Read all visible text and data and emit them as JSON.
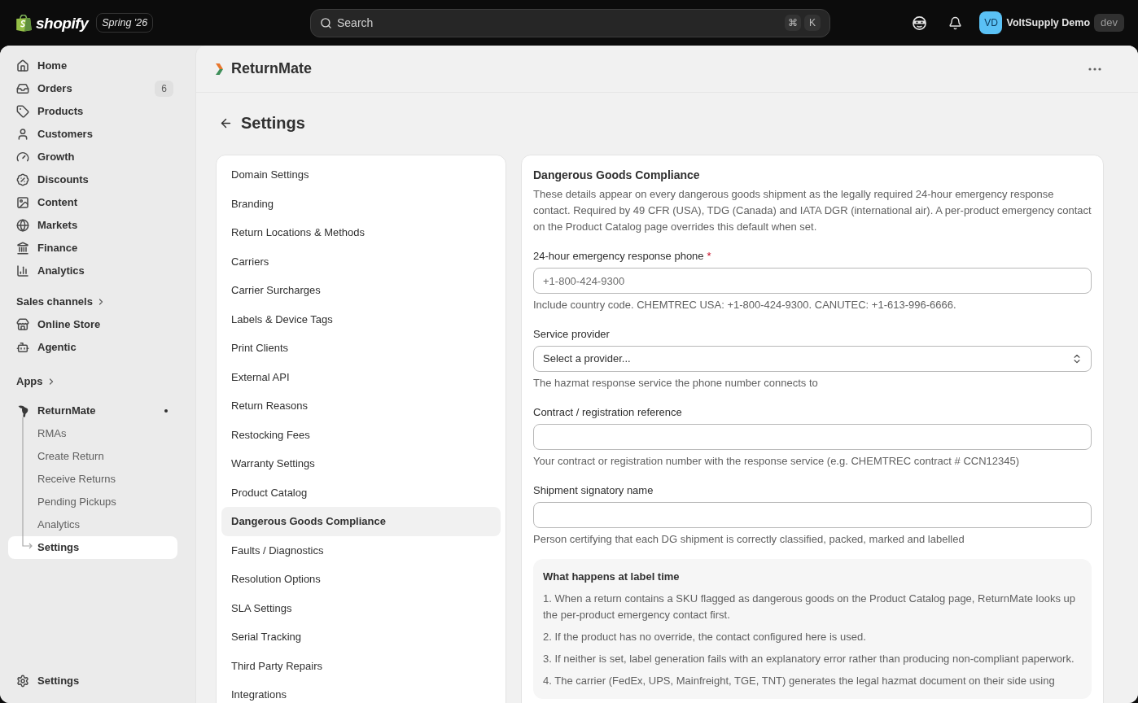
{
  "top_bar": {
    "brand": "shopify",
    "edition": "Spring '26",
    "search": {
      "placeholder": "Search",
      "shortcut": [
        "⌘",
        "K"
      ]
    },
    "account": {
      "initials": "VD",
      "store_name": "VoltSupply Demo",
      "badge": "dev"
    }
  },
  "sidebar": {
    "items": [
      {
        "label": "Home",
        "selected": false
      },
      {
        "label": "Orders",
        "count": "6",
        "selected": false
      },
      {
        "label": "Products",
        "selected": false
      },
      {
        "label": "Customers",
        "selected": false
      },
      {
        "label": "Growth",
        "selected": false
      },
      {
        "label": "Discounts",
        "selected": false
      },
      {
        "label": "Content",
        "selected": false
      },
      {
        "label": "Markets",
        "selected": false
      },
      {
        "label": "Finance",
        "selected": false
      },
      {
        "label": "Analytics",
        "selected": false
      }
    ],
    "sales_channels": {
      "heading": "Sales channels",
      "items": [
        {
          "label": "Online Store",
          "selected": false
        },
        {
          "label": "Agentic",
          "selected": false
        }
      ]
    },
    "apps": {
      "heading": "Apps",
      "items": [
        {
          "label": "ReturnMate",
          "selected": false,
          "indicator": true,
          "children": [
            {
              "label": "RMAs",
              "selected": false
            },
            {
              "label": "Create Return",
              "selected": false
            },
            {
              "label": "Receive Returns",
              "selected": false
            },
            {
              "label": "Pending Pickups",
              "selected": false
            },
            {
              "label": "Analytics",
              "selected": false
            },
            {
              "label": "Settings",
              "selected": true
            }
          ]
        }
      ]
    },
    "footer": {
      "label": "Settings",
      "selected": false
    }
  },
  "app_header": {
    "title": "ReturnMate"
  },
  "page": {
    "title": "Settings"
  },
  "settings_nav": {
    "items": [
      {
        "label": "Domain Settings",
        "selected": false
      },
      {
        "label": "Branding",
        "selected": false
      },
      {
        "label": "Return Locations & Methods",
        "selected": false
      },
      {
        "label": "Carriers",
        "selected": false
      },
      {
        "label": "Carrier Surcharges",
        "selected": false
      },
      {
        "label": "Labels & Device Tags",
        "selected": false
      },
      {
        "label": "Print Clients",
        "selected": false
      },
      {
        "label": "External API",
        "selected": false
      },
      {
        "label": "Return Reasons",
        "selected": false
      },
      {
        "label": "Restocking Fees",
        "selected": false
      },
      {
        "label": "Warranty Settings",
        "selected": false
      },
      {
        "label": "Product Catalog",
        "selected": false
      },
      {
        "label": "Dangerous Goods Compliance",
        "selected": true
      },
      {
        "label": "Faults / Diagnostics",
        "selected": false
      },
      {
        "label": "Resolution Options",
        "selected": false
      },
      {
        "label": "SLA Settings",
        "selected": false
      },
      {
        "label": "Serial Tracking",
        "selected": false
      },
      {
        "label": "Third Party Repairs",
        "selected": false
      },
      {
        "label": "Integrations",
        "selected": false
      }
    ]
  },
  "section": {
    "title": "Dangerous Goods Compliance",
    "description": "These details appear on every dangerous goods shipment as the legally required 24-hour emergency response contact. Required by 49 CFR (USA), TDG (Canada) and IATA DGR (international air). A per-product emergency contact on the Product Catalog page overrides this default when set.",
    "fields": [
      {
        "kind": "text",
        "label": "24-hour emergency response phone",
        "required_mark": "*",
        "placeholder": "+1-800-424-9300",
        "help": "Include country code. CHEMTREC USA: +1-800-424-9300. CANUTEC: +1-613-996-6666."
      },
      {
        "kind": "select",
        "label": "Service provider",
        "value": "Select a provider...",
        "help": "The hazmat response service the phone number connects to"
      },
      {
        "kind": "text",
        "label": "Contract / registration reference",
        "help": "Your contract or registration number with the response service (e.g. CHEMTREC contract # CCN12345)"
      },
      {
        "kind": "text",
        "label": "Shipment signatory name",
        "help": "Person certifying that each DG shipment is correctly classified, packed, marked and labelled"
      }
    ],
    "info_box": {
      "title": "What happens at label time",
      "steps": [
        "1. When a return contains a SKU flagged as dangerous goods on the Product Catalog page, ReturnMate looks up the per-product emergency contact first.",
        "2. If the product has no override, the contact configured here is used.",
        "3. If neither is set, label generation fails with an explanatory error rather than producing non-compliant paperwork.",
        "4. The carrier (FedEx, UPS, Mainfreight, TGE, TNT) generates the legal hazmat document on their side using"
      ]
    }
  }
}
